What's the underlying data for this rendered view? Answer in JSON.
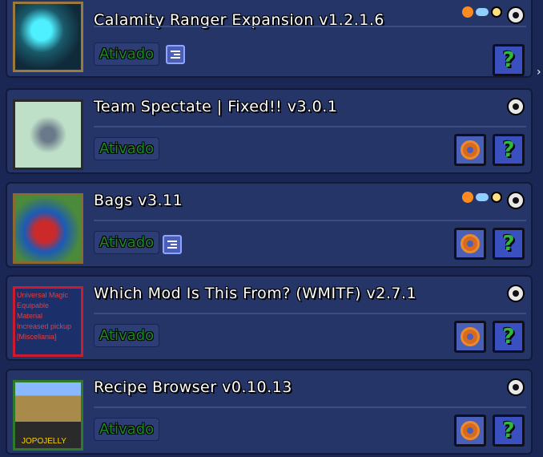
{
  "mods": [
    {
      "name": "Calamity Ranger Expansion v1.2.1.6",
      "status": "Ativado",
      "has_config": true,
      "has_settings": false,
      "side_icons": [
        "fire-icon",
        "cloud-icon",
        "clock-icon"
      ]
    },
    {
      "name": "Team Spectate | Fixed!! v3.0.1",
      "status": "Ativado",
      "has_config": false,
      "has_settings": true,
      "side_icons": []
    },
    {
      "name": "Bags v3.11",
      "status": "Ativado",
      "has_config": true,
      "has_settings": true,
      "side_icons": [
        "fire-icon",
        "cloud-icon",
        "clock-icon"
      ]
    },
    {
      "name": "Which Mod Is This From? (WMITF) v2.7.1",
      "status": "Ativado",
      "has_config": false,
      "has_settings": true,
      "side_icons": [],
      "icon_text": [
        "Universal Magic",
        "Equipable",
        "Material",
        "Increased pickup",
        "[Miscellania]"
      ]
    },
    {
      "name": "Recipe Browser v0.10.13",
      "status": "Ativado",
      "has_config": false,
      "has_settings": true,
      "side_icons": [],
      "icon_text": [
        "JOPOJELLY"
      ]
    }
  ],
  "help_label": "?",
  "colors": {
    "panel": "#253567",
    "background": "#1a2654",
    "status_green": "#1c8a23",
    "help_green": "#2fb83a",
    "gear_orange": "#d86a20"
  }
}
